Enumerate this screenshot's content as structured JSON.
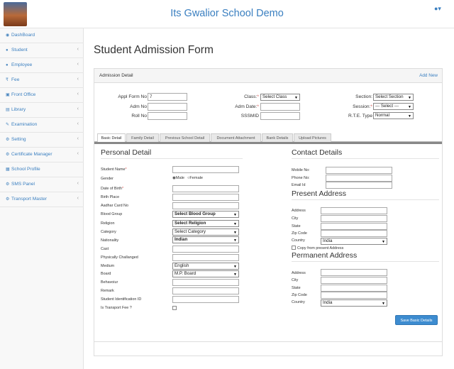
{
  "app": {
    "title": "Its Gwalior School Demo"
  },
  "sidebar": {
    "items": [
      {
        "label": "DashBoard",
        "icon": "dashboard-icon",
        "chev": false
      },
      {
        "label": "Student",
        "icon": "user-icon",
        "chev": true
      },
      {
        "label": "Employee",
        "icon": "user-icon",
        "chev": true
      },
      {
        "label": "Fee",
        "icon": "rupee-icon",
        "chev": true
      },
      {
        "label": "Front Office",
        "icon": "desk-icon",
        "chev": true
      },
      {
        "label": "Library",
        "icon": "book-icon",
        "chev": true
      },
      {
        "label": "Examination",
        "icon": "edit-icon",
        "chev": true
      },
      {
        "label": "Setting",
        "icon": "gear-icon",
        "chev": true
      },
      {
        "label": "Certificate Manager",
        "icon": "gear-icon",
        "chev": true
      },
      {
        "label": "School Profile",
        "icon": "building-icon",
        "chev": false
      },
      {
        "label": "SMS Panel",
        "icon": "gear-icon",
        "chev": true
      },
      {
        "label": "Transport Master",
        "icon": "gear-icon",
        "chev": true
      }
    ]
  },
  "page": {
    "title": "Student Admission Form"
  },
  "panel": {
    "title": "Admission Detail",
    "add_new": "Add New"
  },
  "admission": {
    "appl_form_no_label": "Appl Form No",
    "appl_form_no_value": "7",
    "adm_no_label": "Adm No",
    "roll_no_label": "Roll No",
    "class_label": "Class:",
    "class_value": "Select Class",
    "adm_date_label": "Adm Date:",
    "sssmid_label": "SSSMID",
    "section_label": "Section:",
    "section_value": "Select Section",
    "session_label": "Session:",
    "session_value": "--- Select ---",
    "rte_label": "R.T.E. Type",
    "rte_value": "Normal"
  },
  "tabs": [
    "Basic Detail",
    "Family Detail",
    "Previous School Detail",
    "Document Attachment",
    "Bank Details",
    "Upload Pictures"
  ],
  "personal": {
    "title": "Personal Detail",
    "student_name": "Student Name",
    "gender": "Gender",
    "male": "Male",
    "female": "Female",
    "dob": "Date of Birth",
    "birth_place": "Birth Place",
    "aadhar": "Aadhar Card No",
    "blood_group": "Blood Group",
    "blood_group_value": "Select Blood Group",
    "religion": "Religion",
    "religion_value": "Select Religion",
    "category": "Category",
    "category_value": "Select Category",
    "nationality": "Nationality",
    "nationality_value": "Indian",
    "cast": "Cast",
    "physically": "Physically Challanged",
    "medium": "Medium",
    "medium_value": "English",
    "board": "Board",
    "board_value": "M.P. Board",
    "behaviour": "Behavoiur",
    "remark": "Remark",
    "student_id": "Student Identification ID",
    "transport": "Is Transport Fee ?"
  },
  "contact": {
    "title": "Contact Details",
    "mobile": "Mobile No:",
    "phone": "Phone No:",
    "email": "Email Id"
  },
  "present": {
    "title": "Present Address",
    "address": "Address",
    "city": "City",
    "state": "State",
    "zip": "Zip Code",
    "country": "Country",
    "country_value": "India",
    "copy_label": "Copy from present Address"
  },
  "permanent": {
    "title": "Permanent Address",
    "address": "Address",
    "city": "City",
    "state": "State",
    "zip": "Zip Code",
    "country": "Country",
    "country_value": "India"
  },
  "buttons": {
    "save": "Save Basic Details"
  }
}
